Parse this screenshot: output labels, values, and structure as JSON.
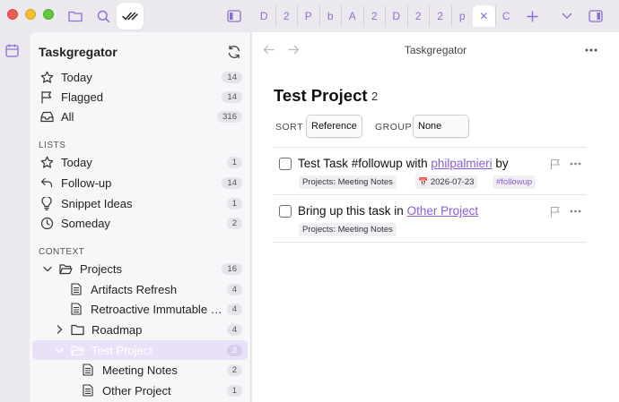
{
  "tabs": [
    "D",
    "2",
    "P",
    "b",
    "A",
    "2",
    "D",
    "2",
    "2",
    "p",
    "✕",
    "C"
  ],
  "sidebar": {
    "title": "Taskgregator",
    "top": [
      {
        "label": "Today",
        "count": "14"
      },
      {
        "label": "Flagged",
        "count": "14"
      },
      {
        "label": "All",
        "count": "316"
      }
    ],
    "lists_heading": "LISTS",
    "lists": [
      {
        "label": "Today",
        "count": "1"
      },
      {
        "label": "Follow-up",
        "count": "14"
      },
      {
        "label": "Snippet Ideas",
        "count": "1"
      },
      {
        "label": "Someday",
        "count": "2"
      }
    ],
    "context_heading": "CONTEXT",
    "context": [
      {
        "label": "Projects",
        "count": "16"
      },
      {
        "label": "Artifacts Refresh",
        "count": "4"
      },
      {
        "label": "Retroactive Immutable Re...",
        "count": "4"
      },
      {
        "label": "Roadmap",
        "count": "4"
      },
      {
        "label": "Test Project",
        "count": "2"
      },
      {
        "label": "Meeting Notes",
        "count": "2"
      },
      {
        "label": "Other Project",
        "count": "1"
      }
    ]
  },
  "main": {
    "nav_title": "Taskgregator",
    "heading": "Test Project",
    "heading_count": "2",
    "sort_label": "SORT",
    "sort_value": "Reference",
    "group_label": "GROUP",
    "group_value": "None",
    "tasks": [
      {
        "text": "Test Task #followup with ",
        "link": "philpalmieri",
        "suffix": " by",
        "project": "Projects: Meeting Notes",
        "date": "2026-07-23",
        "tag": "#followup"
      },
      {
        "text": "Bring up this task in ",
        "link": "Other Project",
        "suffix": "",
        "project": "Projects: Meeting Notes"
      }
    ]
  },
  "colors": {
    "accent": "#8a6fd1",
    "selection": "#e9e1f7",
    "link": "#8a5cd6"
  }
}
